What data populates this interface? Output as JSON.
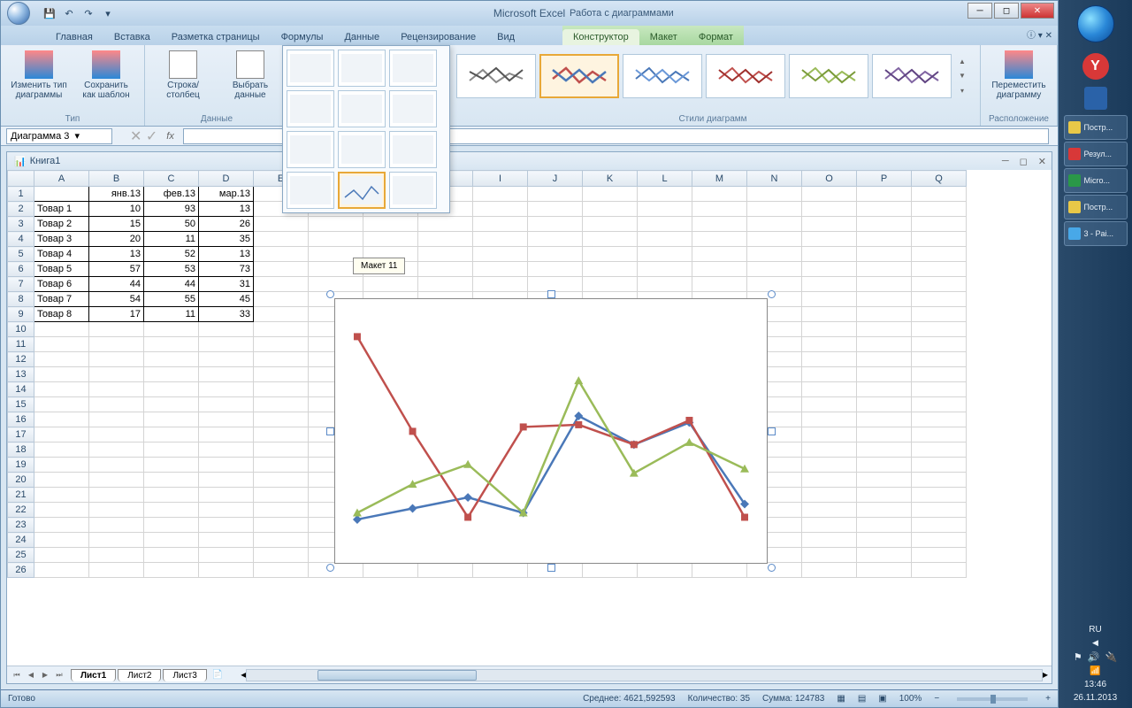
{
  "app": {
    "title": "Microsoft Excel",
    "chart_tools_title": "Работа с диаграммами"
  },
  "tabs": {
    "home": "Главная",
    "insert": "Вставка",
    "page_layout": "Разметка страницы",
    "formulas": "Формулы",
    "data": "Данные",
    "review": "Рецензирование",
    "view": "Вид",
    "design": "Конструктор",
    "layout": "Макет",
    "format": "Формат"
  },
  "ribbon": {
    "change_type": "Изменить тип\nдиаграммы",
    "save_template": "Сохранить\nкак шаблон",
    "group_type": "Тип",
    "switch_row_col": "Строка/столбец",
    "select_data": "Выбрать\nданные",
    "group_data": "Данные",
    "group_styles": "Стили диаграмм",
    "move_chart": "Переместить\nдиаграмму",
    "group_location": "Расположение",
    "tooltip": "Макет 11"
  },
  "namebox": "Диаграмма 3",
  "fx": "fx",
  "workbook": {
    "title": "Книга1"
  },
  "columns": [
    "A",
    "B",
    "C",
    "D",
    "E",
    "F",
    "G",
    "H",
    "I",
    "J",
    "K",
    "L",
    "M",
    "N",
    "O",
    "P",
    "Q"
  ],
  "rows": [
    "1",
    "2",
    "3",
    "4",
    "5",
    "6",
    "7",
    "8",
    "9",
    "10",
    "11",
    "12",
    "13",
    "14",
    "15",
    "16",
    "17",
    "18",
    "19",
    "20",
    "21",
    "22",
    "23",
    "24",
    "25",
    "26"
  ],
  "table": {
    "headers": [
      "",
      "янв.13",
      "фев.13",
      "мар.13"
    ],
    "rows": [
      [
        "Товар 1",
        "10",
        "93",
        "13"
      ],
      [
        "Товар 2",
        "15",
        "50",
        "26"
      ],
      [
        "Товар 3",
        "20",
        "11",
        "35"
      ],
      [
        "Товар 4",
        "13",
        "52",
        "13"
      ],
      [
        "Товар 5",
        "57",
        "53",
        "73"
      ],
      [
        "Товар 6",
        "44",
        "44",
        "31"
      ],
      [
        "Товар 7",
        "54",
        "55",
        "45"
      ],
      [
        "Товар 8",
        "17",
        "11",
        "33"
      ]
    ]
  },
  "sheets": {
    "s1": "Лист1",
    "s2": "Лист2",
    "s3": "Лист3"
  },
  "status": {
    "ready": "Готово",
    "avg": "Среднее: 4621,592593",
    "count": "Количество: 35",
    "sum": "Сумма: 124783",
    "zoom": "100%"
  },
  "taskbar": {
    "items": [
      {
        "label": "Постр...",
        "color": "#e8c848"
      },
      {
        "label": "Резул...",
        "color": "#d83838"
      },
      {
        "label": "Micro...",
        "color": "#2a9848"
      },
      {
        "label": "Постр...",
        "color": "#e8c848"
      },
      {
        "label": "3 - Pai...",
        "color": "#48a8e8"
      }
    ],
    "lang": "RU",
    "time": "13:46",
    "date": "26.11.2013"
  },
  "chart_data": {
    "type": "line",
    "categories": [
      "Товар 1",
      "Товар 2",
      "Товар 3",
      "Товар 4",
      "Товар 5",
      "Товар 6",
      "Товар 7",
      "Товар 8"
    ],
    "series": [
      {
        "name": "янв.13",
        "values": [
          10,
          15,
          20,
          13,
          57,
          44,
          54,
          17
        ],
        "color": "#4a78b8"
      },
      {
        "name": "фев.13",
        "values": [
          93,
          50,
          11,
          52,
          53,
          44,
          55,
          11
        ],
        "color": "#c0504d"
      },
      {
        "name": "мар.13",
        "values": [
          13,
          26,
          35,
          13,
          73,
          31,
          45,
          33
        ],
        "color": "#9abb59"
      }
    ],
    "ylim": [
      0,
      100
    ]
  }
}
